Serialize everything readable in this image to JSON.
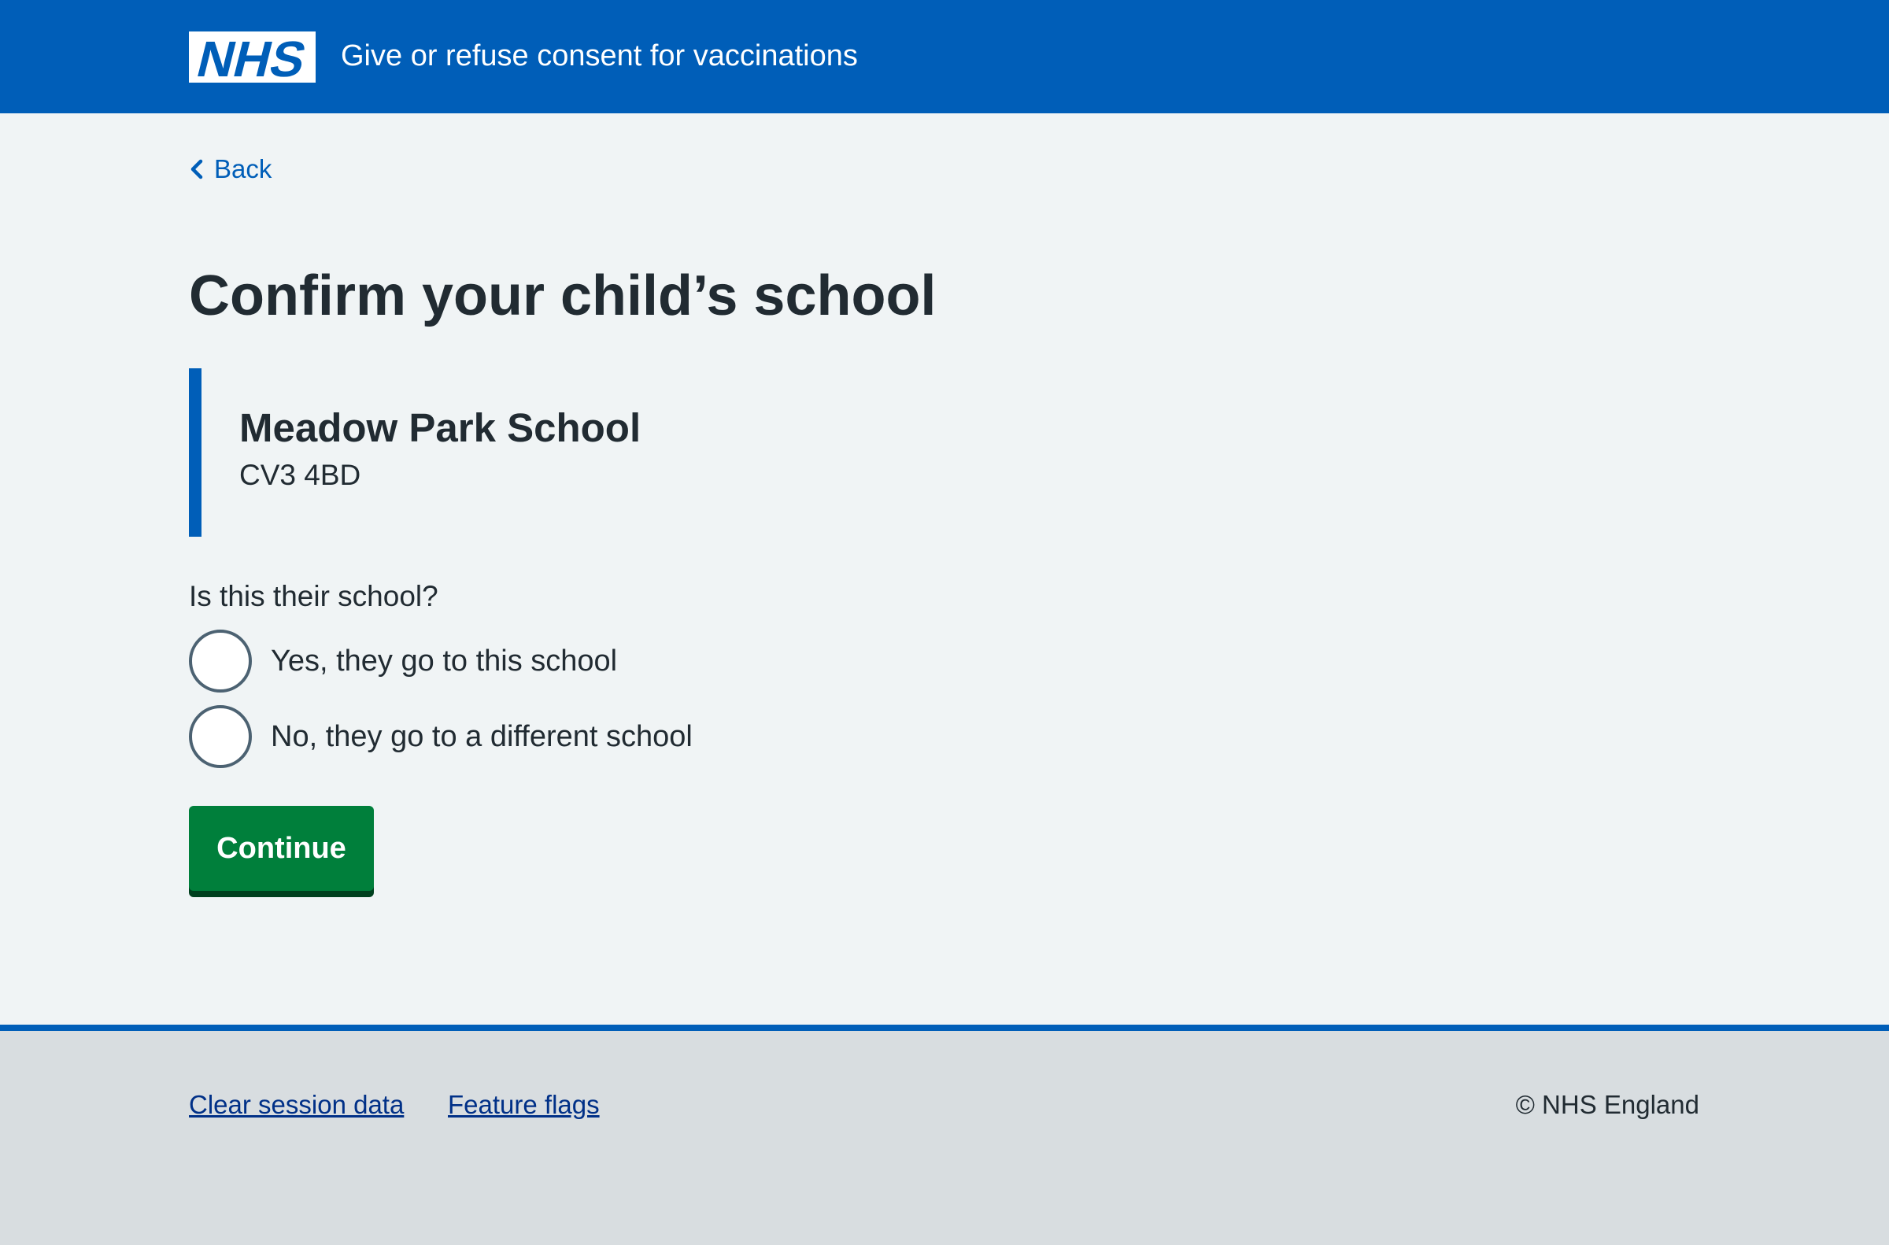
{
  "header": {
    "logo_text": "NHS",
    "service_name": "Give or refuse consent for vaccinations",
    "background_color": "#005eb8"
  },
  "back_link": {
    "label": "Back",
    "icon": "chevron-left-icon"
  },
  "page_title": "Confirm your child’s school",
  "school": {
    "name": "Meadow Park School",
    "postcode": "CV3 4BD"
  },
  "question": {
    "label": "Is this their school?",
    "options": [
      {
        "label": "Yes, they go to this school",
        "selected": false
      },
      {
        "label": "No, they go to a different school",
        "selected": false
      }
    ]
  },
  "continue_button": {
    "label": "Continue",
    "color": "#007f3b"
  },
  "footer": {
    "links": [
      {
        "label": "Clear session data"
      },
      {
        "label": "Feature flags"
      }
    ],
    "copyright": "© NHS England"
  }
}
